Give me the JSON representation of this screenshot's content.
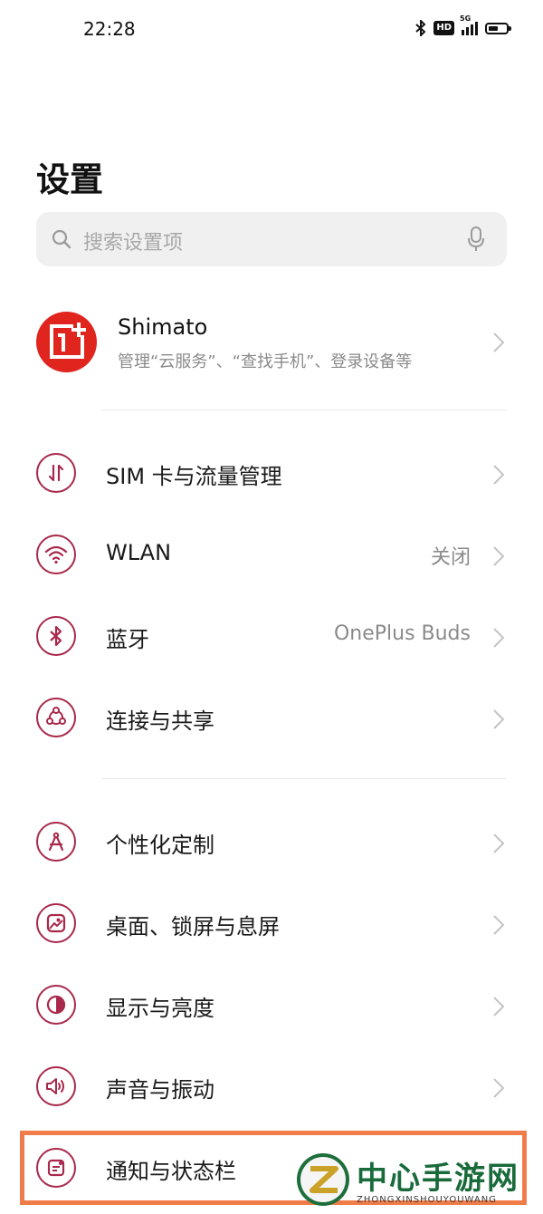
{
  "status_bar": {
    "time": "22:28",
    "hd_label": "HD",
    "network_label": "5G",
    "battery_level": 0.55
  },
  "page_title": "设置",
  "search": {
    "placeholder": "搜索设置项"
  },
  "account": {
    "name": "Shimato",
    "subtitle": "管理“云服务”、“查找手机”、登录设备等"
  },
  "settings_groups": [
    [
      {
        "label": "SIM 卡与流量管理",
        "value": "",
        "icon": "sim-data-icon"
      },
      {
        "label": "WLAN",
        "value": "关闭",
        "icon": "wifi-icon"
      },
      {
        "label": "蓝牙",
        "value": "OnePlus Buds",
        "icon": "bluetooth-icon"
      },
      {
        "label": "连接与共享",
        "value": "",
        "icon": "connection-sharing-icon"
      }
    ],
    [
      {
        "label": "个性化定制",
        "value": "",
        "icon": "personalization-icon"
      },
      {
        "label": "桌面、锁屏与息屏",
        "value": "",
        "icon": "home-lockscreen-icon"
      },
      {
        "label": "显示与亮度",
        "value": "",
        "icon": "display-brightness-icon"
      },
      {
        "label": "声音与振动",
        "value": "",
        "icon": "sound-vibration-icon"
      },
      {
        "label": "通知与状态栏",
        "value": "",
        "icon": "notification-statusbar-icon"
      }
    ]
  ],
  "colors": {
    "accent": "#a8294c",
    "avatar_bg": "#e0251f",
    "highlight_border": "#f07c4a"
  },
  "watermark": {
    "text": "中心手游网",
    "subtext": "ZHONGXINSHOUYOUWANG"
  }
}
